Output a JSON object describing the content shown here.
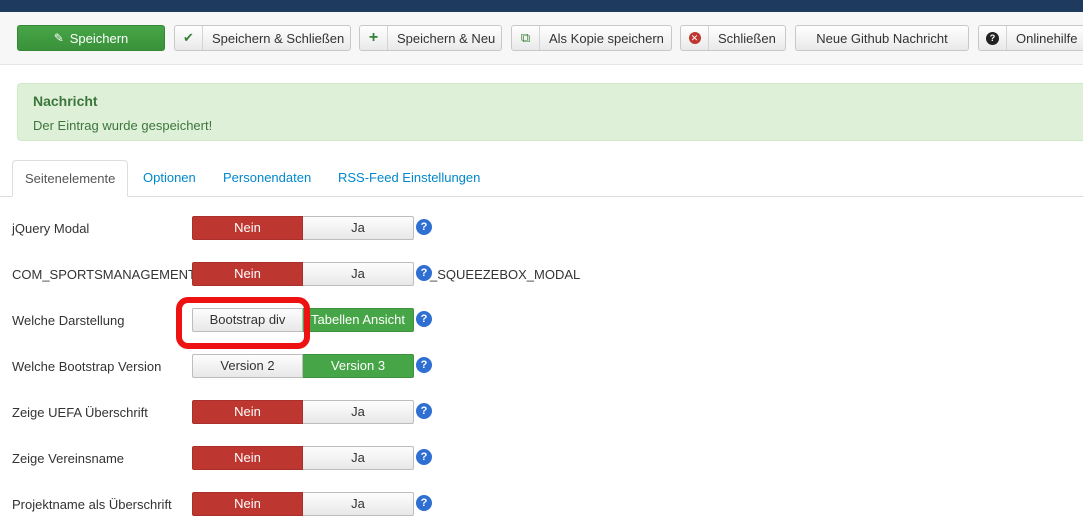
{
  "toolbar": {
    "save": "Speichern",
    "save_close": "Speichern & Schließen",
    "save_new": "Speichern & Neu",
    "save_copy": "Als Kopie speichern",
    "close": "Schließen",
    "github": "Neue Github Nachricht",
    "help": "Onlinehilfe"
  },
  "message": {
    "title": "Nachricht",
    "text": "Der Eintrag wurde gespeichert!"
  },
  "tabs": [
    "Seitenelemente",
    "Optionen",
    "Personendaten",
    "RSS-Feed Einstellungen"
  ],
  "active_tab": "Seitenelemente",
  "fields": [
    {
      "label": "jQuery Modal",
      "options": [
        "Nein",
        "Ja"
      ],
      "selected": "Nein"
    },
    {
      "label": "COM_SPORTSMANAGEMENT",
      "options": [
        "Nein",
        "Ja"
      ],
      "selected": "Nein",
      "suffix": "_SQUEEZEBOX_MODAL"
    },
    {
      "label": "Welche Darstellung",
      "options": [
        "Bootstrap div",
        "Tabellen Ansicht"
      ],
      "selected": "Tabellen Ansicht"
    },
    {
      "label": "Welche Bootstrap Version",
      "options": [
        "Version 2",
        "Version 3"
      ],
      "selected": "Version 3"
    },
    {
      "label": "Zeige UEFA Überschrift",
      "options": [
        "Nein",
        "Ja"
      ],
      "selected": "Nein"
    },
    {
      "label": "Zeige Vereinsname",
      "options": [
        "Nein",
        "Ja"
      ],
      "selected": "Nein"
    },
    {
      "label": "Projektname als Überschrift",
      "options": [
        "Nein",
        "Ja"
      ],
      "selected": "Nein"
    }
  ],
  "help_glyph": "?",
  "colors": {
    "header": "#1f3a5f",
    "success": "#46a546",
    "danger": "#bd362f",
    "help": "#2f6fd2",
    "annotation": "#ee1111"
  }
}
